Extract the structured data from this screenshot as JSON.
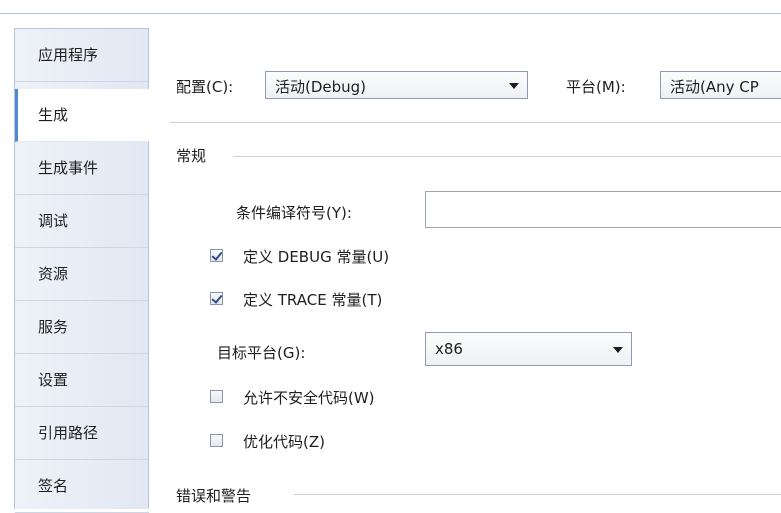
{
  "sidebar": {
    "items": [
      {
        "label": "应用程序"
      },
      {
        "label": "生成"
      },
      {
        "label": "生成事件"
      },
      {
        "label": "调试"
      },
      {
        "label": "资源"
      },
      {
        "label": "服务"
      },
      {
        "label": "设置"
      },
      {
        "label": "引用路径"
      },
      {
        "label": "签名"
      }
    ],
    "active_index": 1
  },
  "config": {
    "label": "配置(C):",
    "value": "活动(Debug)"
  },
  "platform": {
    "label": "平台(M):",
    "value": "活动(Any CP"
  },
  "general": {
    "title": "常规",
    "symbols_label": "条件编译符号(Y):",
    "symbols_value": "",
    "define_debug": {
      "label": "定义 DEBUG 常量(U)",
      "checked": true
    },
    "define_trace": {
      "label": "定义 TRACE 常量(T)",
      "checked": true
    },
    "target_label": "目标平台(G):",
    "target_value": "x86",
    "unsafe": {
      "label": "允许不安全代码(W)",
      "checked": false
    },
    "optimize": {
      "label": "优化代码(Z)",
      "checked": false
    }
  },
  "errors": {
    "title": "错误和警告"
  },
  "colors": {
    "accent": "#4f8ad6",
    "sidebar_bg": "#e6ecf5"
  }
}
